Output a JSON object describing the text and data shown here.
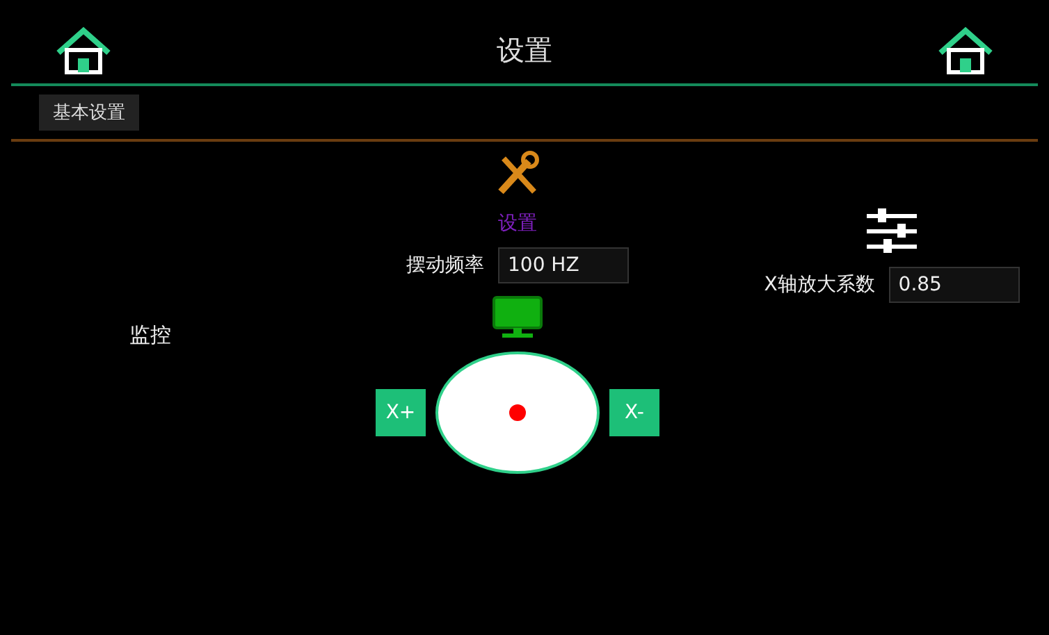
{
  "window": {
    "title": "设置"
  },
  "tabs": [
    {
      "label": "基本设置"
    }
  ],
  "section_label": "设置",
  "fields": [
    {
      "label": "摆动频率",
      "value": "100 HZ"
    },
    {
      "label": "X轴放大系数",
      "value": "0.85"
    }
  ],
  "monitor": {
    "label": "监控"
  },
  "jog": {
    "minus_label": "X-",
    "plus_label": "X+"
  }
}
